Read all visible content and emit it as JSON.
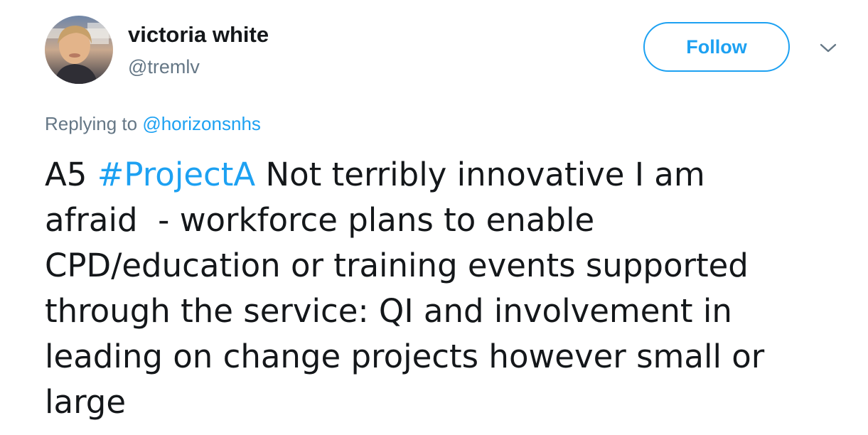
{
  "user": {
    "display_name": "victoria white",
    "handle": "@tremlv",
    "avatar_icon": "profile-photo"
  },
  "actions": {
    "follow_label": "Follow",
    "menu_icon": "chevron-down-icon"
  },
  "reply": {
    "prefix": "Replying to ",
    "mention": "@horizonsnhs"
  },
  "tweet": {
    "text_before": "A5 ",
    "hashtag": "#ProjectA",
    "text_after": " Not terribly innovative I am\nafraid  - workforce plans to enable\nCPD/education or training events supported\nthrough the service: QI and involvement in\nleading on change projects however small or\nlarge"
  },
  "colors": {
    "accent": "#1da1f2",
    "secondary_text": "#657786",
    "primary_text": "#14171a"
  }
}
